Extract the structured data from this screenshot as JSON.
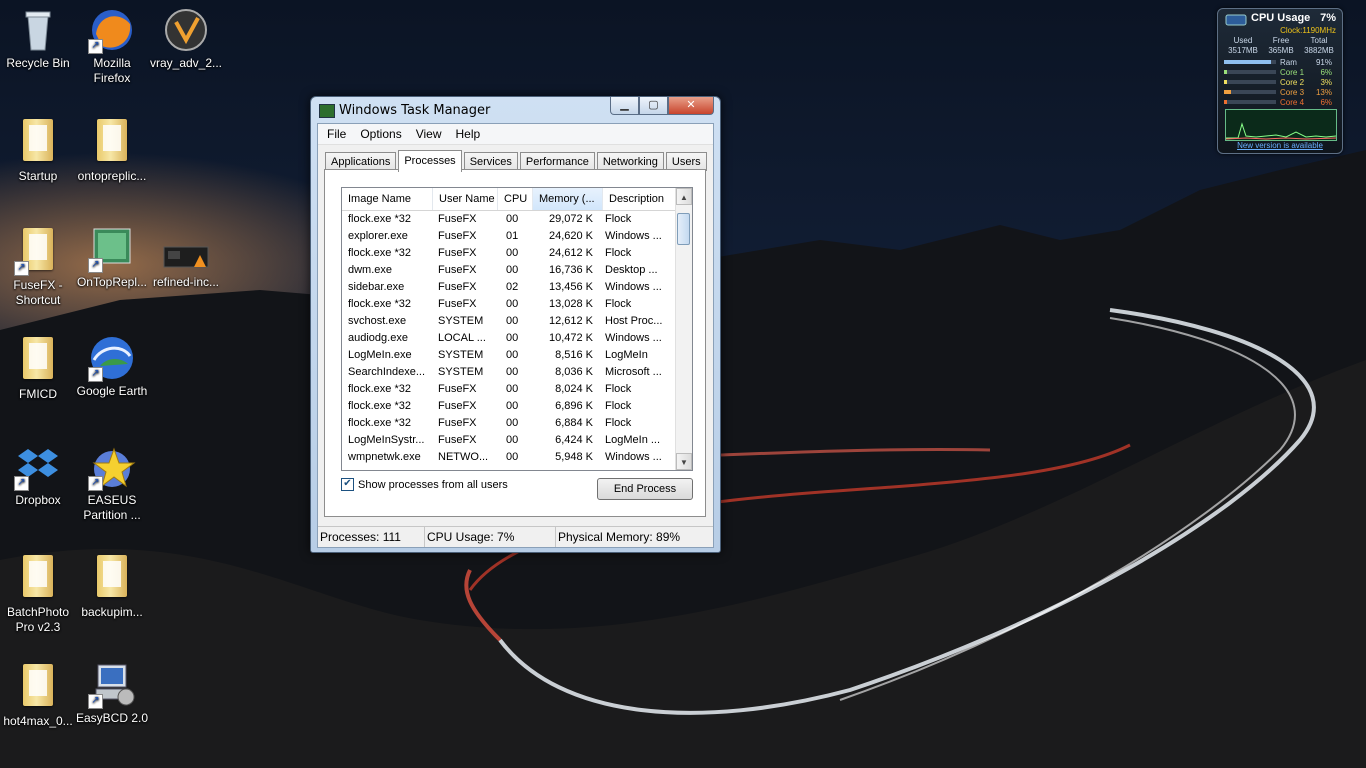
{
  "desktop": {
    "icons": [
      {
        "label": "Recycle Bin",
        "icon": "recycle-bin-icon"
      },
      {
        "label": "Mozilla Firefox",
        "icon": "firefox-icon"
      },
      {
        "label": "vray_adv_2...",
        "icon": "vray-icon"
      },
      {
        "label": "Startup",
        "icon": "folder-icon"
      },
      {
        "label": "ontopreplic...",
        "icon": "folder-icon"
      },
      {
        "label": "FuseFX - Shortcut",
        "icon": "folder-shortcut-icon"
      },
      {
        "label": "OnTopRepl...",
        "icon": "app-shortcut-icon"
      },
      {
        "label": "refined-inc...",
        "icon": "image-file-icon"
      },
      {
        "label": "FMICD",
        "icon": "folder-icon"
      },
      {
        "label": "Google Earth",
        "icon": "google-earth-icon"
      },
      {
        "label": "Dropbox",
        "icon": "dropbox-icon"
      },
      {
        "label": "EASEUS Partition ...",
        "icon": "easeus-icon"
      },
      {
        "label": "BatchPhoto Pro v2.3",
        "icon": "folder-icon"
      },
      {
        "label": "backupim...",
        "icon": "folder-icon"
      },
      {
        "label": "hot4max_0...",
        "icon": "folder-icon"
      },
      {
        "label": "EasyBCD 2.0",
        "icon": "easybcd-icon"
      }
    ]
  },
  "taskmgr": {
    "title": "Windows Task Manager",
    "buttons": {
      "minimize": "▁",
      "maximize": "▢",
      "close": "✕"
    },
    "menu": [
      "File",
      "Options",
      "View",
      "Help"
    ],
    "tabs": [
      "Applications",
      "Processes",
      "Services",
      "Performance",
      "Networking",
      "Users"
    ],
    "active_tab": "Processes",
    "columns": [
      "Image Name",
      "User Name",
      "CPU",
      "Memory (...",
      "Description"
    ],
    "rows": [
      [
        "flock.exe *32",
        "FuseFX",
        "00",
        "29,072 K",
        "Flock"
      ],
      [
        "explorer.exe",
        "FuseFX",
        "01",
        "24,620 K",
        "Windows ..."
      ],
      [
        "flock.exe *32",
        "FuseFX",
        "00",
        "24,612 K",
        "Flock"
      ],
      [
        "dwm.exe",
        "FuseFX",
        "00",
        "16,736 K",
        "Desktop ..."
      ],
      [
        "sidebar.exe",
        "FuseFX",
        "02",
        "13,456 K",
        "Windows ..."
      ],
      [
        "flock.exe *32",
        "FuseFX",
        "00",
        "13,028 K",
        "Flock"
      ],
      [
        "svchost.exe",
        "SYSTEM",
        "00",
        "12,612 K",
        "Host Proc..."
      ],
      [
        "audiodg.exe",
        "LOCAL ...",
        "00",
        "10,472 K",
        "Windows ..."
      ],
      [
        "LogMeIn.exe",
        "SYSTEM",
        "00",
        "8,516 K",
        "LogMeIn"
      ],
      [
        "SearchIndexe...",
        "SYSTEM",
        "00",
        "8,036 K",
        "Microsoft ..."
      ],
      [
        "flock.exe *32",
        "FuseFX",
        "00",
        "8,024 K",
        "Flock"
      ],
      [
        "flock.exe *32",
        "FuseFX",
        "00",
        "6,896 K",
        "Flock"
      ],
      [
        "flock.exe *32",
        "FuseFX",
        "00",
        "6,884 K",
        "Flock"
      ],
      [
        "LogMeInSystr...",
        "FuseFX",
        "00",
        "6,424 K",
        "LogMeIn ..."
      ],
      [
        "wmpnetwk.exe",
        "NETWO...",
        "00",
        "5,948 K",
        "Windows ..."
      ]
    ],
    "show_all_label": "Show processes from all users",
    "show_all_checked": "✔",
    "end_process_label": "End Process",
    "status": {
      "processes": "Processes: 111",
      "cpu": "CPU Usage: 7%",
      "memory": "Physical Memory: 89%"
    }
  },
  "gadget": {
    "title": "CPU Usage",
    "cpu_pct": "7%",
    "clock": "Clock:1190MHz",
    "mem_headers": [
      "Used",
      "Free",
      "Total"
    ],
    "mem_values": [
      "3517MB",
      "365MB",
      "3882MB"
    ],
    "bars": [
      {
        "label": "Ram",
        "value": "91%",
        "fill": 0.91,
        "color": "#8fc0f0"
      },
      {
        "label": "Core 1",
        "value": "6%",
        "fill": 0.06,
        "color": "#9be07a"
      },
      {
        "label": "Core 2",
        "value": "3%",
        "fill": 0.03,
        "color": "#f0e060"
      },
      {
        "label": "Core 3",
        "value": "13%",
        "fill": 0.13,
        "color": "#f0a040"
      },
      {
        "label": "Core 4",
        "value": "6%",
        "fill": 0.06,
        "color": "#f07030"
      }
    ],
    "link": "New version is available"
  }
}
